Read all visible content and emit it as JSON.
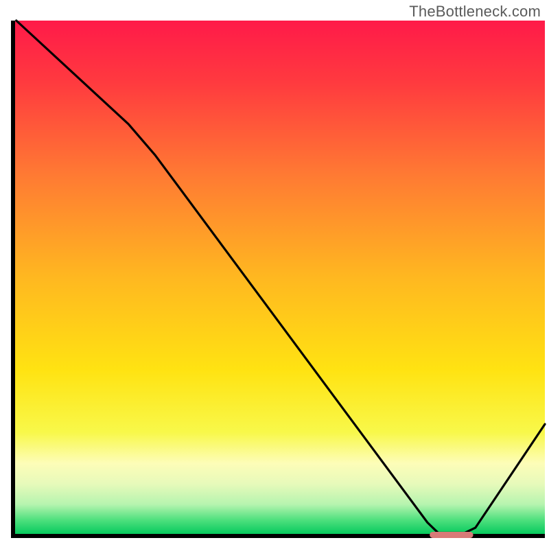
{
  "watermark": "TheBottleneck.com",
  "chart_data": {
    "type": "line",
    "title": "",
    "xlabel": "",
    "ylabel": "",
    "xlim": [
      0,
      100
    ],
    "ylim": [
      0,
      100
    ],
    "gradient_stops": [
      {
        "offset": 0.0,
        "color": "#ff1a49"
      },
      {
        "offset": 0.12,
        "color": "#ff3a3f"
      },
      {
        "offset": 0.3,
        "color": "#ff7a33"
      },
      {
        "offset": 0.5,
        "color": "#ffb820"
      },
      {
        "offset": 0.68,
        "color": "#ffe312"
      },
      {
        "offset": 0.8,
        "color": "#f8f84a"
      },
      {
        "offset": 0.86,
        "color": "#fdfdb8"
      },
      {
        "offset": 0.9,
        "color": "#e7faba"
      },
      {
        "offset": 0.94,
        "color": "#b6f4af"
      },
      {
        "offset": 0.97,
        "color": "#4fe07e"
      },
      {
        "offset": 1.0,
        "color": "#00c85a"
      }
    ],
    "series": [
      {
        "name": "bottleneck-curve",
        "type": "line",
        "points": [
          {
            "x": 1,
            "y": 100
          },
          {
            "x": 22,
            "y": 80
          },
          {
            "x": 27,
            "y": 74
          },
          {
            "x": 78,
            "y": 3
          },
          {
            "x": 80,
            "y": 1
          },
          {
            "x": 85,
            "y": 1
          },
          {
            "x": 87,
            "y": 2
          },
          {
            "x": 100,
            "y": 22
          }
        ]
      }
    ],
    "marker": {
      "name": "optimal-range",
      "x_start": 79,
      "x_end": 86,
      "y": 0.6,
      "color": "#d87a78",
      "thickness": 9
    },
    "axes": {
      "left": {
        "x": 2,
        "y0": 0,
        "y1": 100
      },
      "bottom": {
        "y": 0,
        "x0": 2,
        "x1": 100
      }
    }
  }
}
